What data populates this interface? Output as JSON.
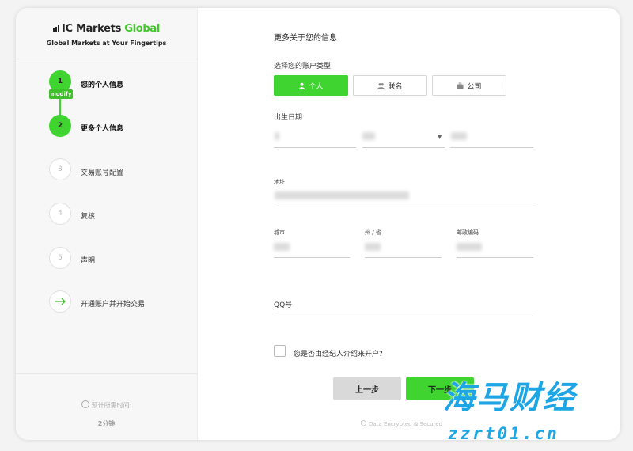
{
  "sidebar": {
    "logo": {
      "brand": "IC Markets",
      "suffix": "Global"
    },
    "tagline": "Global Markets at Your Fingertips",
    "steps": [
      {
        "number": "1",
        "label": "您的个人信息",
        "state": "done",
        "badge": "modify"
      },
      {
        "number": "2",
        "label": "更多个人信息",
        "state": "active"
      },
      {
        "number": "3",
        "label": "交易账号配置",
        "state": "pending"
      },
      {
        "number": "4",
        "label": "复核",
        "state": "pending"
      },
      {
        "number": "5",
        "label": "声明",
        "state": "pending"
      },
      {
        "number": "",
        "icon": "arrow-right-icon",
        "label": "开通账户并开始交易",
        "state": "pending"
      }
    ],
    "time_label": "预计所需时间:",
    "time_value": "2分钟"
  },
  "main": {
    "title": "更多关于您的信息",
    "account_type_label": "选择您的账户类型",
    "account_types": [
      {
        "label": "个人",
        "icon": "person-icon",
        "selected": true
      },
      {
        "label": "联名",
        "icon": "people-icon",
        "selected": false
      },
      {
        "label": "公司",
        "icon": "briefcase-icon",
        "selected": false
      }
    ],
    "dob_label": "出生日期",
    "address_label": "地址",
    "city_label": "城市",
    "state_label": "州 / 省",
    "postcode_label": "邮政编码",
    "qq_label": "QQ号",
    "referral_question": "您是否由经纪人介绍来开户?",
    "prev_button": "上一步",
    "next_button": "下一步",
    "secure_text": "Data Encrypted & Secured"
  },
  "watermark": {
    "text": "海马财经",
    "url": "zzrt01.cn"
  },
  "colors": {
    "accent": "#3fd42f",
    "watermark": "#1ea6e4"
  }
}
